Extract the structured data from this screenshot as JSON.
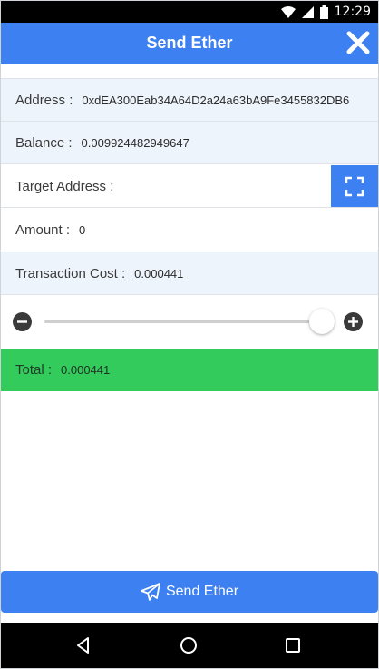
{
  "status_bar": {
    "time": "12:29"
  },
  "header": {
    "title": "Send Ether"
  },
  "form": {
    "address_label": "Address :",
    "address_value": "0xdEA300Eab34A64D2a24a63bA9Fe3455832DB6",
    "balance_label": "Balance :",
    "balance_value": "0.009924482949647",
    "target_label": "Target Address :",
    "target_value": "",
    "amount_label": "Amount :",
    "amount_value": "0",
    "cost_label": "Transaction Cost :",
    "cost_value": "0.000441"
  },
  "fee_slider": {
    "level": 1.0
  },
  "total": {
    "label": "Total :",
    "value": "0.000441"
  },
  "send_button": {
    "label": "Send Ether"
  },
  "colors": {
    "primary": "#3d80f1",
    "total_bg": "#33cc5c",
    "row_alt": "#eef4fc"
  },
  "icons": [
    "wifi-icon",
    "signal-icon",
    "battery-icon",
    "close-icon",
    "scan-icon",
    "minus-icon",
    "plus-icon",
    "paper-plane-icon",
    "back-icon",
    "home-icon",
    "recents-icon"
  ]
}
